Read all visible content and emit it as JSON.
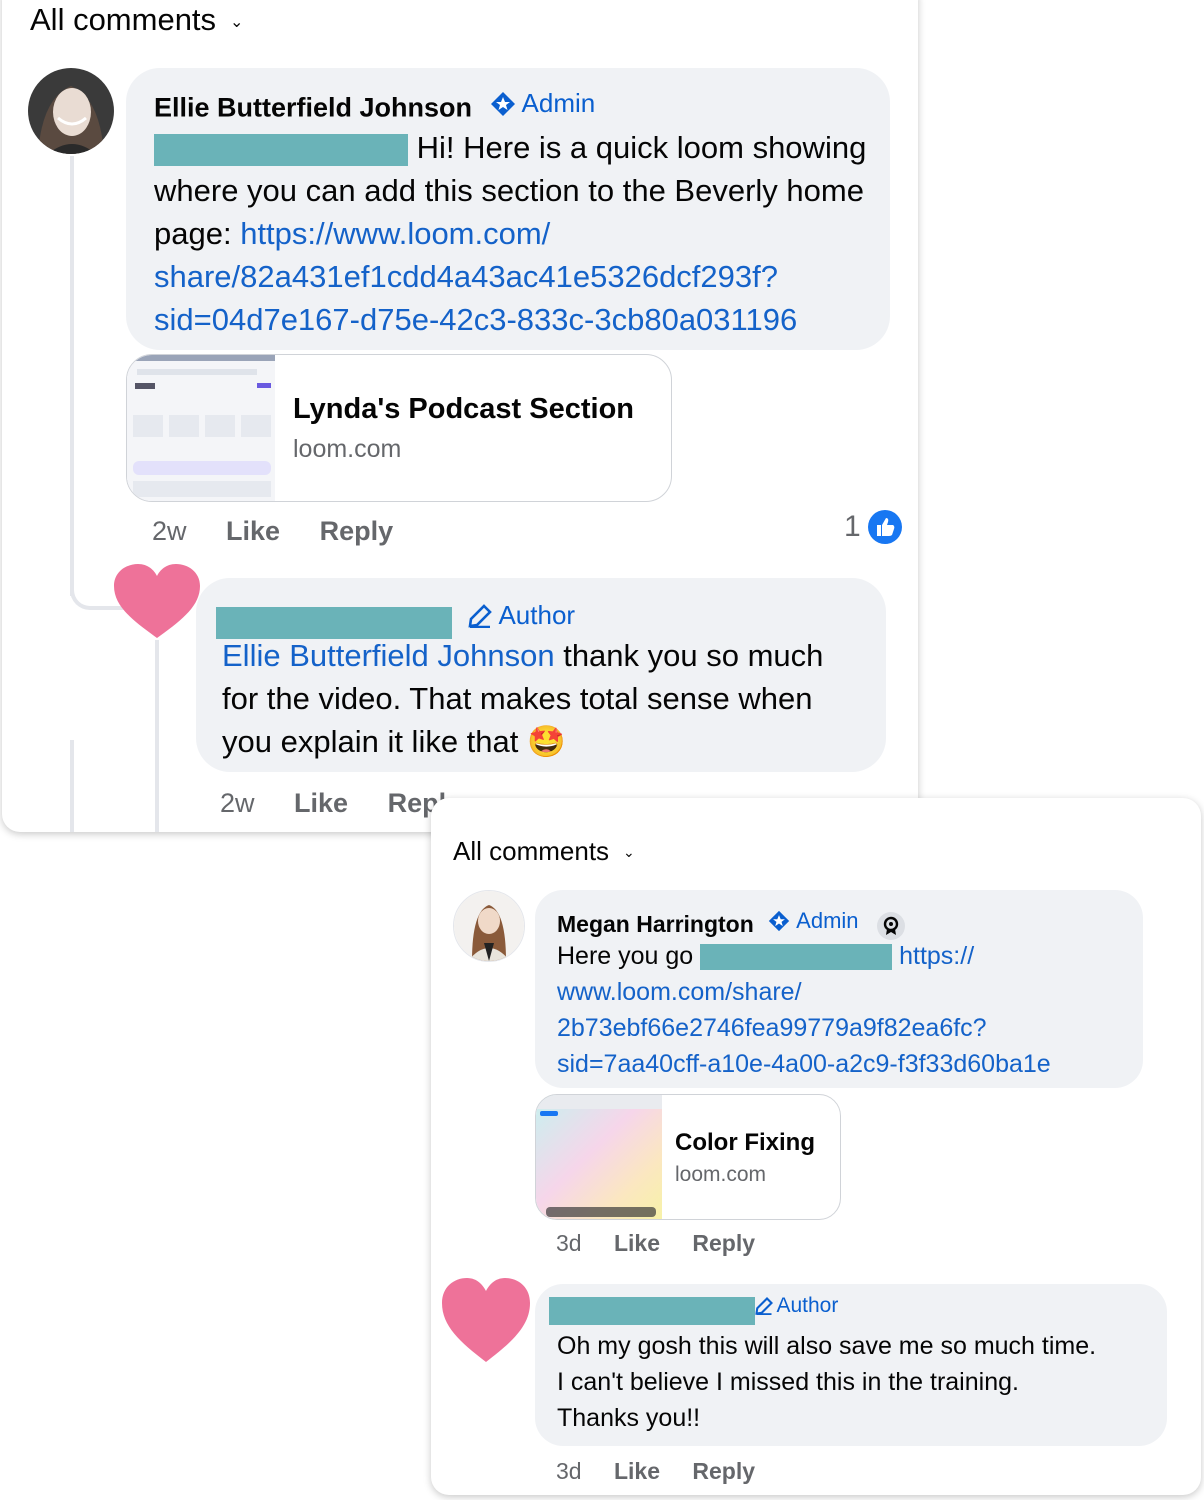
{
  "card1": {
    "header": "All comments",
    "comment": {
      "author": "Ellie Butterfield Johnson",
      "badge": "Admin",
      "text": "Hi! Here is a quick loom showing where you can add this section to the Beverly home page:",
      "link_line1": "https://www.loom.com/",
      "link_line2": "share/82a431ef1cdd4a43ac41e5326dcf293f?",
      "link_line3": "sid=04d7e167-d75e-42c3-833c-3cb80a031196",
      "preview_title": "Lynda's Podcast Section",
      "preview_domain": "loom.com",
      "time": "2w",
      "like": "Like",
      "reply": "Reply",
      "reaction_count": "1"
    },
    "reply": {
      "badge": "Author",
      "mention": "Ellie Butterfield Johnson",
      "text_line1": " thank you so much",
      "text_line2": "for the video. That makes total sense when",
      "text_line3": "you explain it like that",
      "emoji": "🤩",
      "time": "2w",
      "like": "Like",
      "reply": "Repl"
    }
  },
  "card2": {
    "header": "All comments",
    "comment": {
      "author": "Megan Harrington",
      "badge": "Admin",
      "text": "Here you go",
      "link_line1": "https://",
      "link_line2": "www.loom.com/share/",
      "link_line3": "2b73ebf66e2746fea99779a9f82ea6fc?",
      "link_line4": "sid=7aa40cff-a10e-4a00-a2c9-f3f33d60ba1e",
      "preview_title": "Color Fixing",
      "preview_domain": "loom.com",
      "time": "3d",
      "like": "Like",
      "reply": "Reply"
    },
    "reply": {
      "badge": "Author",
      "text_line1": "Oh my gosh this will also save me so much time.",
      "text_line2": "I can't believe I missed this in the training.",
      "text_line3": "Thanks you!!",
      "time": "3d",
      "like": "Like",
      "reply": "Reply"
    }
  },
  "colors": {
    "link": "#1462c9",
    "badge": "#0a5fcf",
    "bubble": "#f0f2f5",
    "redaction": "#6ab3b8",
    "heart": "#ee7299",
    "like_reaction": "#1877f2"
  },
  "icons": [
    "chevron-down-icon",
    "admin-badge-icon",
    "author-pencil-icon",
    "like-reaction-icon",
    "heart-icon",
    "top-fan-badge-icon",
    "avatar"
  ]
}
